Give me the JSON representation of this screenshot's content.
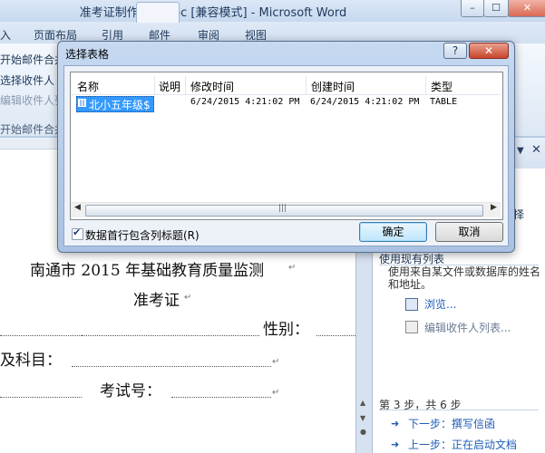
{
  "window": {
    "title": "准考证制作模板.doc [兼容模式] - Microsoft Word",
    "min": "–",
    "max": "☐",
    "close": "✕"
  },
  "ribbon": {
    "tabs": [
      "入",
      "页面布局",
      "引用",
      "邮件",
      "审阅",
      "视图"
    ],
    "items": [
      "开始邮件合并",
      "选择收件人",
      "编辑收件人列表",
      "开始邮件合并"
    ]
  },
  "dialog": {
    "title": "选择表格",
    "help": "?",
    "close": "✕",
    "columns": [
      "名称",
      "说明",
      "修改时间",
      "创建时间",
      "类型"
    ],
    "rows": [
      {
        "name": "北小五年级$",
        "description": "",
        "modified": "6/24/2015 4:21:02 PM",
        "created": "6/24/2015 4:21:02 PM",
        "type": "TABLE",
        "selected": true
      }
    ],
    "checkbox": {
      "label": "数据首行包含列标题(R)",
      "checked": true
    },
    "ok": "确定",
    "cancel": "取消",
    "scroll_left": "◀",
    "scroll_right": "▶",
    "scroll_grip": "|||"
  },
  "document": {
    "heading": "南通市 2015 年基础教育质量监测",
    "subheading": "准考证",
    "line1_label": "性别：",
    "line2_label": "及科目：",
    "line3_label": "考试号：",
    "para_mark": "↵"
  },
  "task_pane": {
    "tail_text": "择",
    "section_heading": "使用现有列表",
    "desc": "使用来自某文件或数据库的姓名和地址。",
    "link_browse": "浏览...",
    "link_edit": "编辑收件人列表...",
    "step": "第 3 步，共 6 步",
    "next": "下一步：撰写信函",
    "prev": "上一步：正在启动文档",
    "dropdown": "▼",
    "close": "✕"
  },
  "colors": {
    "accent": "#3399ff",
    "link": "#1d5cb8",
    "chrome": "#c9d7ea"
  }
}
